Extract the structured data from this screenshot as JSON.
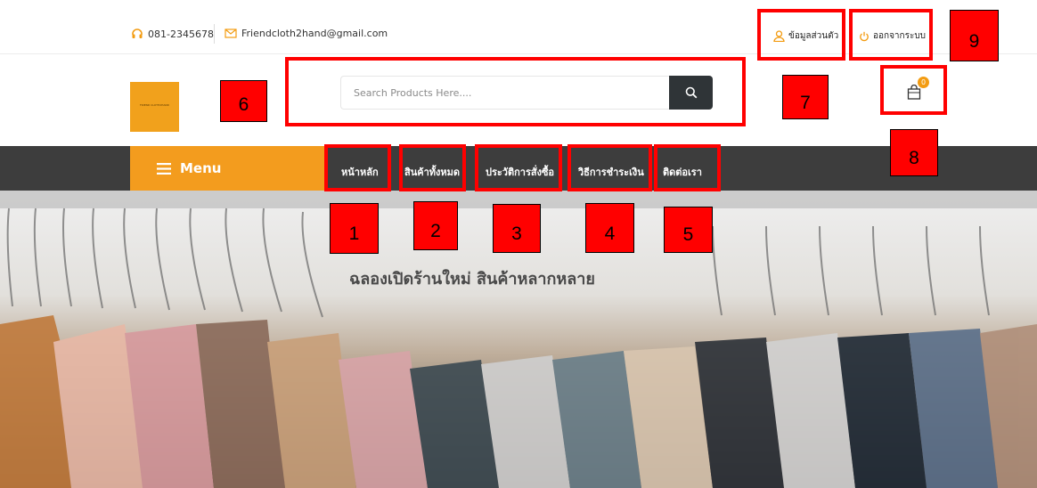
{
  "topbar": {
    "phone": "081-2345678",
    "email": "Friendcloth2hand@gmail.com",
    "profile_label": "ข้อมูลส่วนตัว",
    "logout_label": "ออกจากระบบ"
  },
  "logo": {
    "text": "FRIEND CLOTH2HAND"
  },
  "search": {
    "placeholder": "Search Products Here...."
  },
  "cart": {
    "count": "0"
  },
  "nav": {
    "menu_label": "Menu",
    "items": [
      {
        "label": "หน้าหลัก"
      },
      {
        "label": "สินค้าทั้งหมด"
      },
      {
        "label": "ประวัติการสั่งซื้อ"
      },
      {
        "label": "วิธีการชำระเงิน"
      },
      {
        "label": "ติดต่อเรา"
      }
    ]
  },
  "hero": {
    "title": "ฉลองเปิดร้านใหม่ สินค้าหลากหลาย"
  },
  "annotations": [
    "1",
    "2",
    "3",
    "4",
    "5",
    "6",
    "7",
    "8",
    "9"
  ],
  "colors": {
    "accent": "#f39c1e",
    "nav_bg": "#3d3d3d",
    "annotation": "#ff0000"
  }
}
